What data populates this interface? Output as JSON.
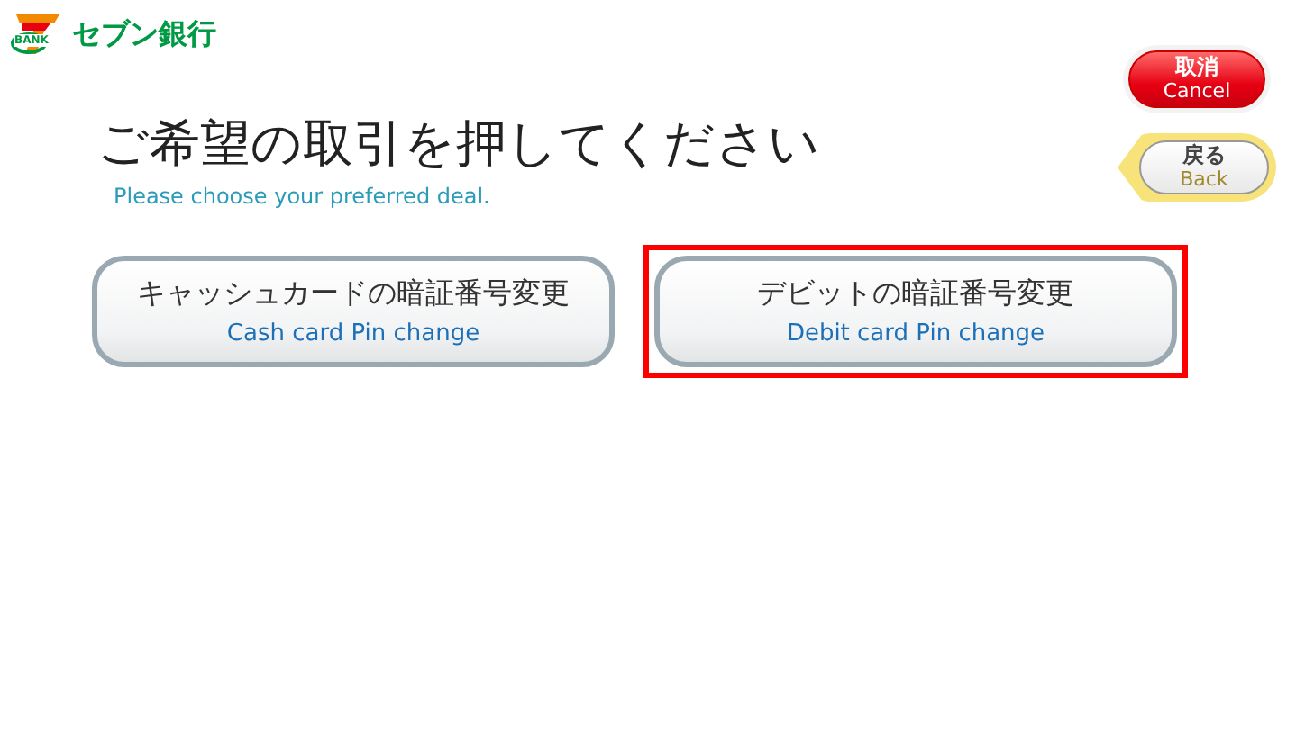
{
  "header": {
    "bank_name": "セブン銀行",
    "logo_text": "BANK"
  },
  "title": "ご希望の取引を押してください",
  "subtitle": "Please choose your preferred deal.",
  "nav_buttons": [
    {
      "kind": "cancel",
      "label": "取消",
      "label_en": "Cancel"
    },
    {
      "kind": "back",
      "label": "戻る",
      "label_en": "Back"
    }
  ],
  "options": [
    {
      "label": "キャッシュカードの暗証番号変更",
      "label_en": "Cash card Pin change",
      "selected": false
    },
    {
      "label": "デビットの暗証番号変更",
      "label_en": "Debit card Pin change",
      "selected": true
    }
  ]
}
